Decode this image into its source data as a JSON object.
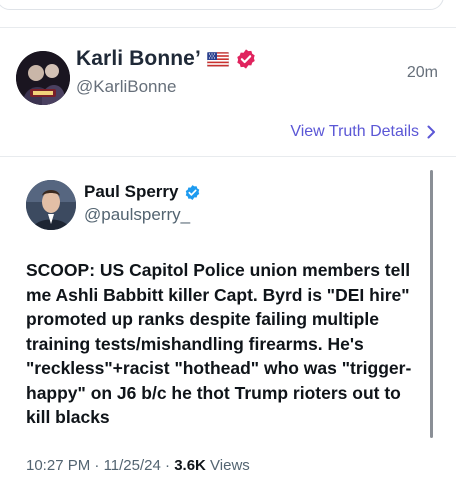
{
  "post": {
    "display_name": "Karli Bonne’",
    "handle": "@KarliBonne",
    "time_ago": "20m",
    "flag_icon": "us-flag-icon",
    "verified_icon": "verified-badge-icon",
    "verified_color": "#e0245e",
    "view_details_label": "View Truth Details",
    "link_color": "#5b57d6"
  },
  "quote": {
    "display_name": "Paul Sperry",
    "handle": "@paulsperry_",
    "verified_color": "#1d9bf0",
    "text": "SCOOP: US Capitol Police union members tell me Ashli Babbitt killer Capt. Byrd is \"DEI hire\" promoted up ranks despite failing multiple training tests/mishandling firearms. He's \"reckless\"+racist \"hothead\" who was \"trigger-happy\" on J6 b/c he thot Trump rioters out to kill blacks",
    "time": "10:27 PM",
    "date": "11/25/24",
    "views_count": "3.6K",
    "views_label": "Views"
  }
}
